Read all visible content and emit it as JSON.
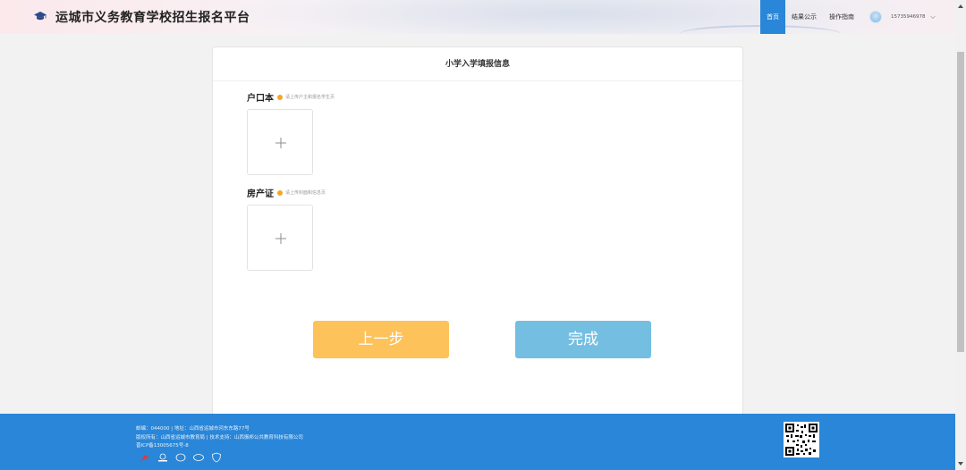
{
  "header": {
    "title": "运城市义务教育学校招生报名平台",
    "nav": [
      "首页",
      "结果公示",
      "操作指南"
    ],
    "active_nav": 0,
    "user_phone": "15735946978"
  },
  "form": {
    "title": "小学入学填报信息",
    "fields": [
      {
        "label": "户口本",
        "hint": "请上传户主和报名学生页"
      },
      {
        "label": "房产证",
        "hint": "请上传封面和信息页"
      }
    ],
    "prev_label": "上一步",
    "done_label": "完成"
  },
  "footer": {
    "line1": "邮编：044000 | 地址：山西省运城市河东东路77号",
    "line2": "版权所有：山西省运城市教育局 | 技术支持：山西振邦公共教育科技有限公司",
    "line3": "晋ICP备13005675号-8"
  },
  "colors": {
    "primary": "#2a86d8",
    "prev_button": "#fdc259",
    "done_button": "#74bfe1",
    "hint_dot": "#f5a623"
  }
}
